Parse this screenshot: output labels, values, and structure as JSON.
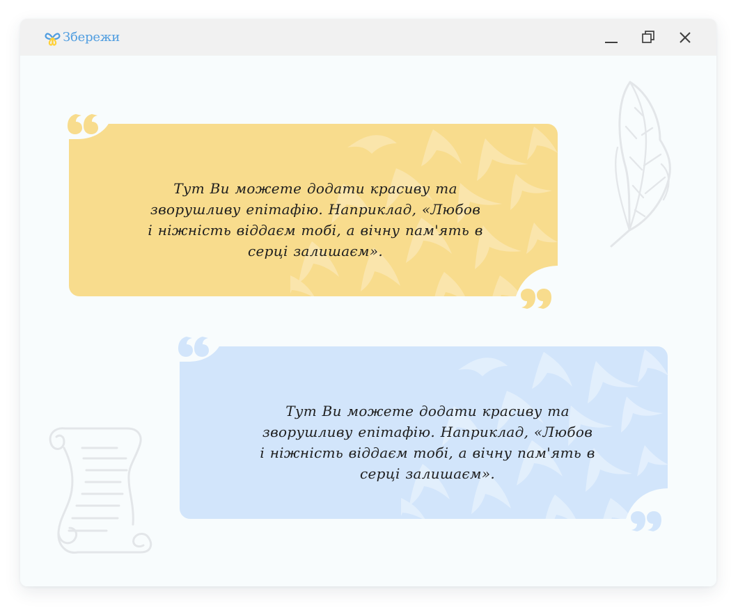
{
  "app": {
    "logo_text": "Збережи",
    "logo_icon": "butterfly-logo-icon"
  },
  "window_controls": {
    "minimize_icon": "minimize-icon",
    "maximize_icon": "maximize-icon",
    "close_icon": "close-icon"
  },
  "decorations": {
    "feather_icon": "feather-icon",
    "scroll_icon": "scroll-icon",
    "birds_pattern": "swallows-pattern"
  },
  "quotes": [
    {
      "text": "Тут Ви можете додати красиву та зворушливу епітафію. Наприклад, «Любов і ніжність віддаєм тобі, а вічну пам'ять в серці залишаєм».",
      "color": "#f8dc8d",
      "mark_color": "#f8dc8d"
    },
    {
      "text": "Тут Ви можете додати красиву та зворушливу епітафію. Наприклад, «Любов і ніжність віддаєм тобі, а вічну пам'ять в серці залишаєм».",
      "color": "#d2e5fb",
      "mark_color": "#d2e5fb"
    }
  ],
  "colors": {
    "window_background": "#f8fcfd",
    "titlebar_background": "#f1f1f1",
    "logo_blue": "#4f9de0",
    "logo_yellow": "#ffd13a",
    "text": "#1e1e1e",
    "decor_line": "#e4e7ea"
  }
}
